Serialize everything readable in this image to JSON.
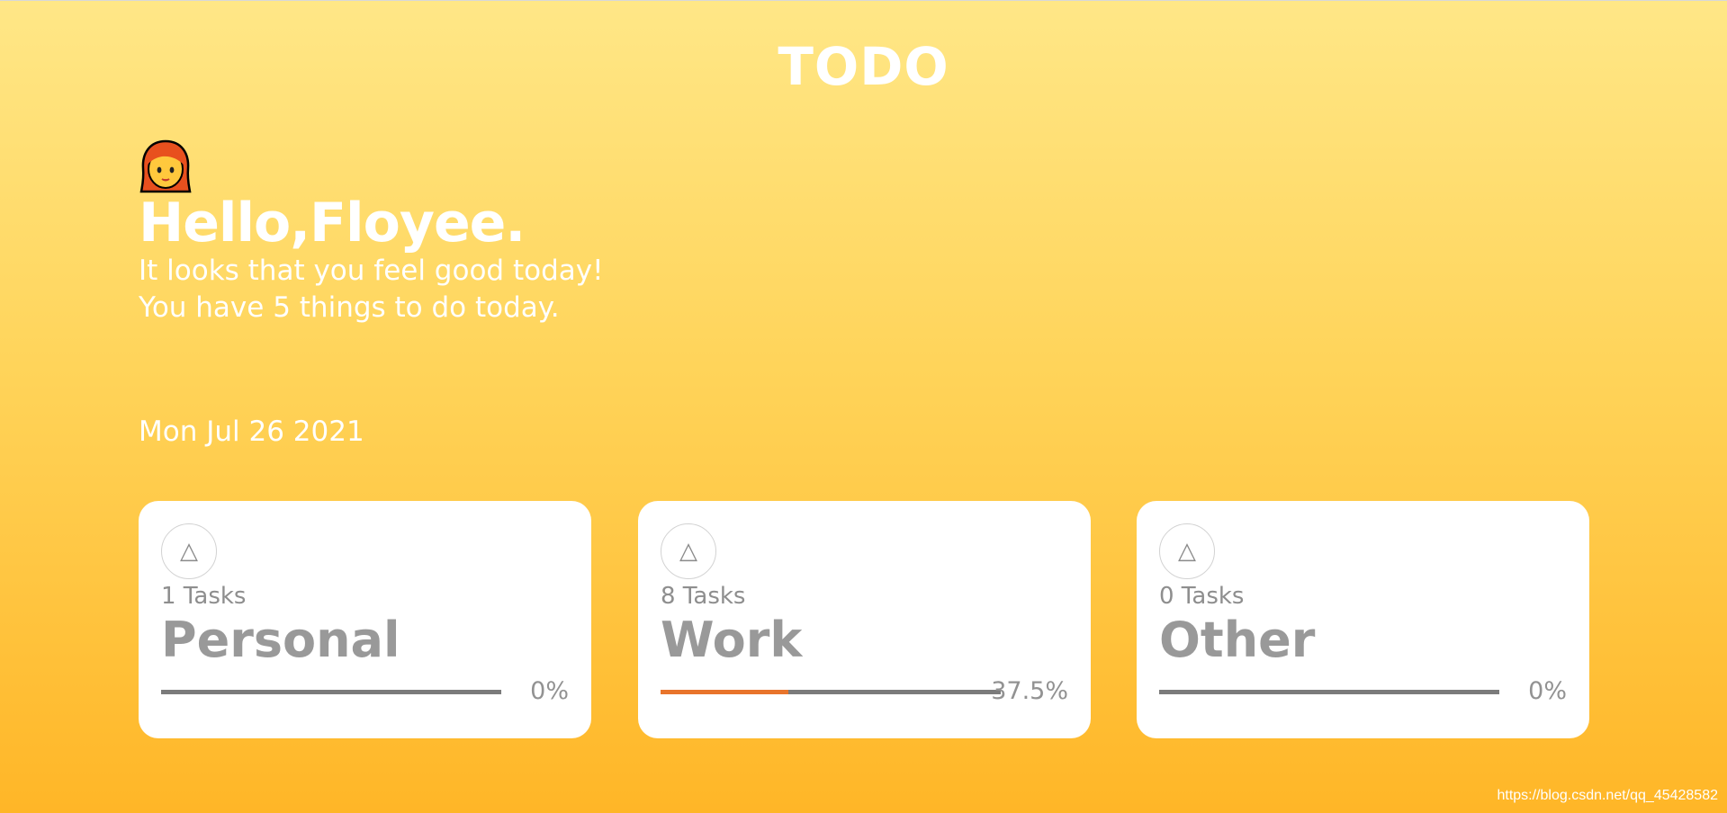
{
  "header": {
    "title": "TODO"
  },
  "greeting": {
    "avatar_icon": "woman-red-hair-emoji-icon",
    "hello": "Hello,Floyee.",
    "line1": "It looks that you feel good today!",
    "line2": "You have 5 things to do today."
  },
  "date": "Mon Jul 26 2021",
  "categories": [
    {
      "icon": "triangle-icon",
      "icon_glyph": "△",
      "count": "1 Tasks",
      "name": "Personal",
      "progress_label": "0%",
      "progress": 0
    },
    {
      "icon": "triangle-icon",
      "icon_glyph": "△",
      "count": "8 Tasks",
      "name": "Work",
      "progress_label": "37.5%",
      "progress": 0.375
    },
    {
      "icon": "triangle-icon",
      "icon_glyph": "△",
      "count": "0 Tasks",
      "name": "Other",
      "progress_label": "0%",
      "progress": 0
    }
  ],
  "colors": {
    "progress_fill": "#e8742b",
    "progress_track": "#7b7b7b"
  },
  "watermark": "https://blog.csdn.net/qq_45428582"
}
